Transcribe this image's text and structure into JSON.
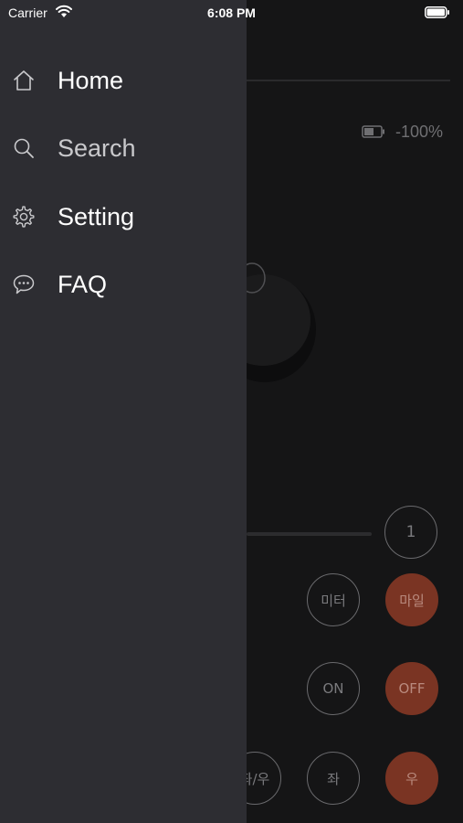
{
  "status_bar": {
    "carrier": "Carrier",
    "time": "6:08 PM"
  },
  "drawer": {
    "items": [
      {
        "label": "Home",
        "icon": "home-icon"
      },
      {
        "label": "Search",
        "icon": "search-icon"
      },
      {
        "label": "Setting",
        "icon": "gear-icon"
      },
      {
        "label": "FAQ",
        "icon": "chat-bubble-icon"
      }
    ]
  },
  "background": {
    "battery_text": "-100%",
    "count_button": "1",
    "unit_buttons": [
      "미터",
      "마일"
    ],
    "power_buttons": [
      "ON",
      "OFF"
    ],
    "direction_buttons": [
      "좌/우",
      "좌",
      "우"
    ]
  },
  "colors": {
    "drawer_bg": "#2d2d32",
    "screen_bg": "#151516",
    "accent": "#7a3423"
  }
}
